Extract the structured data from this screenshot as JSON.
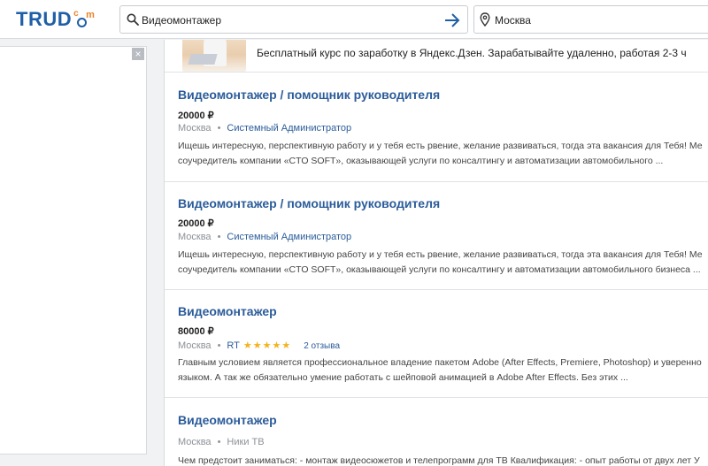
{
  "header": {
    "logo_text": "TRUD",
    "logo_c": "c",
    "logo_m": "m",
    "search_value": "Видеомонтажер",
    "location_value": "Москва"
  },
  "ad": {
    "close_label": "×"
  },
  "promo": {
    "text": "Бесплатный курс по заработку в Яндекс.Дзен. Зарабатывайте удаленно, работая 2-3 ч"
  },
  "jobs": [
    {
      "title": "Видеомонтажер / помощник руководителя",
      "salary": "20000 ₽",
      "city": "Москва",
      "separator": "•",
      "company": "Системный Администратор",
      "desc_line1": "Ищешь интересную, перспективную работу и у тебя есть рвение, желание развиваться, тогда эта вакансия для Тебя! Ме",
      "desc_line2": "соучредитель компании «CTO SOFT», оказывающей услуги по консалтингу и автоматизации автомобильного ..."
    },
    {
      "title": "Видеомонтажер / помощник руководителя",
      "salary": "20000 ₽",
      "city": "Москва",
      "separator": "•",
      "company": "Системный Администратор",
      "desc_line1": "Ищешь интересную, перспективную работу и у тебя есть рвение, желание развиваться, тогда эта вакансия для Тебя! Ме",
      "desc_line2": "соучредитель компании «CTO SOFT», оказывающей услуги по консалтингу и автоматизации автомобильного бизнеса ..."
    },
    {
      "title": "Видеомонтажер",
      "salary": "80000 ₽",
      "city": "Москва",
      "separator": "•",
      "company": "RT",
      "stars": "★★★★★",
      "rating": 5,
      "reviews": "2 отзыва",
      "desc_line1": "Главным условием является профессиональное владение пакетом Adobe (After Effects, Premiere, Photoshop) и уверенно",
      "desc_line2": "языком. А так же обязательно умение работать с шейповой анимацией в Adobe After Effects. Без этих ..."
    },
    {
      "title": "Видеомонтажер",
      "city": "Москва",
      "separator": "•",
      "company": "Ники ТВ",
      "desc_line1": "Чем предстоит заниматься: - монтаж видеосюжетов и телепрограмм для ТВ Квалификация: - опыт работы от двух лет У"
    }
  ],
  "colors": {
    "brand": "#1f5fa6",
    "accent": "#e8842a",
    "link": "#2b5c9a",
    "star": "#f4b21b"
  }
}
